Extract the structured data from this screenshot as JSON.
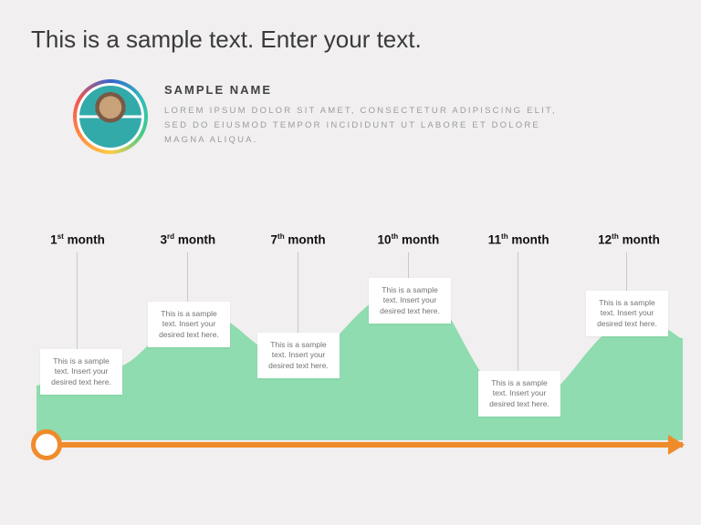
{
  "title": "This is a sample text. Enter your text.",
  "profile": {
    "name": "SAMPLE NAME",
    "description": "LOREM IPSUM DOLOR SIT AMET, CONSECTETUR ADIPISCING ELIT, SED DO EIUSMOD TEMPOR INCIDIDUNT UT LABORE ET DOLORE MAGNA ALIQUA."
  },
  "timeline": {
    "months": [
      {
        "ord": "1",
        "suf": "st",
        "word": "month"
      },
      {
        "ord": "3",
        "suf": "rd",
        "word": "month"
      },
      {
        "ord": "7",
        "suf": "th",
        "word": "month"
      },
      {
        "ord": "10",
        "suf": "th",
        "word": "month"
      },
      {
        "ord": "11",
        "suf": "th",
        "word": "month"
      },
      {
        "ord": "12",
        "suf": "th",
        "word": "month"
      }
    ],
    "box_text": "This is a sample text.  Insert your desired text here.",
    "colors": {
      "wave": "#8edcaf",
      "arrow": "#f08b2b"
    }
  },
  "chart_data": {
    "type": "area",
    "title": "",
    "xlabel": "month",
    "ylabel": "",
    "categories": [
      "1st month",
      "3rd month",
      "7th month",
      "10th month",
      "11th month",
      "12th month"
    ],
    "values": [
      60,
      120,
      75,
      135,
      34,
      110
    ],
    "ylim": [
      0,
      160
    ],
    "annotations": [
      "This is a sample text.  Insert your desired text here.",
      "This is a sample text.  Insert your desired text here.",
      "This is a sample text.  Insert your desired text here.",
      "This is a sample text.  Insert your desired text here.",
      "This is a sample text.  Insert your desired text here.",
      "This is a sample text.  Insert your desired text here."
    ]
  }
}
